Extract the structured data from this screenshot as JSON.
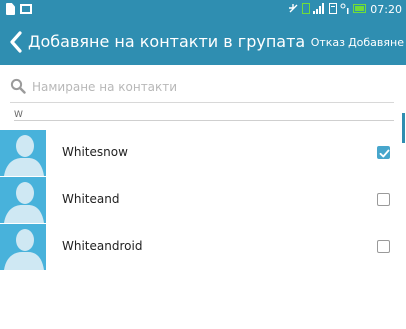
{
  "status_bar": {
    "time": "07:20",
    "icons": [
      "document-icon",
      "message-icon",
      "mute-icon",
      "signal-icon",
      "sim-icon",
      "wifi-icon",
      "battery-icon"
    ],
    "battery_color": "#6fdc3a"
  },
  "header": {
    "title": "Добавяне на контакти в групата",
    "cancel_label": "Отказ",
    "add_label": "Добавяне",
    "background": "#2f8eb1"
  },
  "search": {
    "placeholder": "Намиране на контакти",
    "value": ""
  },
  "section": {
    "letter": "W"
  },
  "contacts": [
    {
      "name": "Whitesnow",
      "checked": true
    },
    {
      "name": "Whiteand",
      "checked": false
    },
    {
      "name": "Whiteandroid",
      "checked": false
    }
  ],
  "colors": {
    "accent": "#2f8eb1",
    "avatar": "#48b2db",
    "checkbox_checked": "#47a6cc"
  }
}
